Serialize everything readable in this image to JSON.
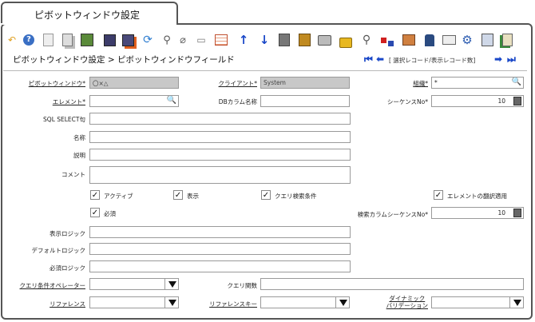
{
  "tab": {
    "title": "ピボットウィンドウ設定"
  },
  "toolbar": {
    "icons": [
      "undo-icon",
      "help-icon",
      "new-record-icon",
      "copy-record-icon",
      "delete-icon",
      "save-icon",
      "save-new-icon",
      "refresh-icon",
      "find-icon",
      "attachment-icon",
      "chat-icon",
      "grid-toggle-icon",
      "parent-record-icon",
      "detail-record-icon",
      "history-icon",
      "report-icon",
      "print-icon",
      "lock-icon",
      "zoom-across-icon",
      "workflow-icon",
      "product-info-icon",
      "archive-icon",
      "request-icon",
      "process-icon",
      "export-icon",
      "exit-icon"
    ]
  },
  "breadcrumb": {
    "text": "ピボットウィンドウ設定 > ピボットウィンドウフィールド"
  },
  "record_nav": {
    "status": "[ 選択レコード/表示レコード数]"
  },
  "fields": {
    "pivot_window": {
      "label": "ピボットウィンドウ*",
      "value": "〇×△"
    },
    "client": {
      "label": "クライアント*",
      "value": "System"
    },
    "organization": {
      "label": "組織*",
      "value": "*"
    },
    "element": {
      "label": "エレメント*",
      "value": ""
    },
    "db_column": {
      "label": "DBカラム名称",
      "value": ""
    },
    "sequence": {
      "label": "シーケンスNo*",
      "value": "10"
    },
    "sql_select": {
      "label": "SQL SELECT句",
      "value": ""
    },
    "name": {
      "label": "名称",
      "value": ""
    },
    "description": {
      "label": "説明",
      "value": ""
    },
    "comment": {
      "label": "コメント",
      "value": ""
    },
    "search_seq": {
      "label": "検索カラムシーケンスNo*",
      "value": "10"
    },
    "display_logic": {
      "label": "表示ロジック",
      "value": ""
    },
    "default_logic": {
      "label": "デフォルトロジック",
      "value": ""
    },
    "mandatory_logic": {
      "label": "必須ロジック",
      "value": ""
    },
    "query_operator": {
      "label": "クエリ条件オペレーター",
      "value": ""
    },
    "query_function": {
      "label": "クエリ関数",
      "value": ""
    },
    "reference": {
      "label": "リファレンス",
      "value": ""
    },
    "reference_key": {
      "label": "リファレンスキー",
      "value": ""
    },
    "dynamic_validation_1": {
      "label": "ダイナミック"
    },
    "dynamic_validation_2": {
      "label": "バリデーション",
      "value": ""
    }
  },
  "checkboxes": {
    "active": {
      "label": "アクティブ",
      "checked": true
    },
    "display": {
      "label": "表示",
      "checked": true
    },
    "query_criteria": {
      "label": "クエリ検索条件",
      "checked": true
    },
    "translate": {
      "label": "エレメントの翻訳適用",
      "checked": true
    },
    "mandatory": {
      "label": "必須",
      "checked": true
    }
  },
  "glyphs": {
    "check": "✓",
    "search": "🔍"
  }
}
